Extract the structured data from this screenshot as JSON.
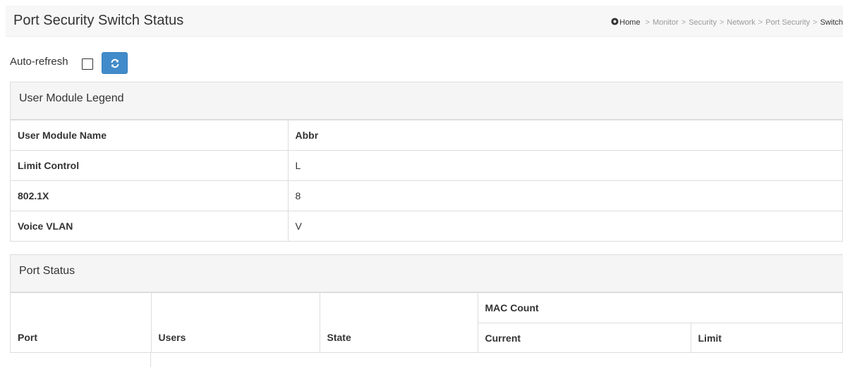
{
  "header": {
    "title": "Port Security Switch Status",
    "breadcrumb": [
      "Home",
      "Monitor",
      "Security",
      "Network",
      "Port Security",
      "Switch"
    ]
  },
  "refresh": {
    "auto_refresh_label": "Auto-refresh",
    "auto_refresh_checked": false,
    "refresh_icon": "refresh-icon"
  },
  "legend": {
    "heading": "User Module Legend",
    "columns": [
      "User Module Name",
      "Abbr"
    ],
    "rows": [
      {
        "name": "Limit Control",
        "abbr": "L"
      },
      {
        "name": "802.1X",
        "abbr": "8"
      },
      {
        "name": "Voice VLAN",
        "abbr": "V"
      }
    ]
  },
  "port_status": {
    "heading": "Port Status",
    "columns": {
      "port": "Port",
      "users": "Users",
      "state": "State",
      "mac_count": "MAC Count",
      "current": "Current",
      "limit": "Limit"
    }
  },
  "colors": {
    "accent": "#428bca",
    "panel_heading_bg": "#f5f5f5",
    "border": "#dddddd"
  }
}
